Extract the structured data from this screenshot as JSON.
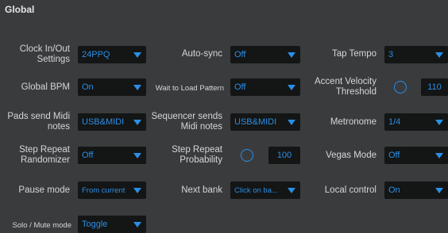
{
  "panel": {
    "title": "Global"
  },
  "rows": {
    "clock": {
      "label": "Clock In/Out Settings",
      "value": "24PPQ"
    },
    "auto_sync": {
      "label": "Auto-sync",
      "value": "Off"
    },
    "tap_tempo": {
      "label": "Tap Tempo",
      "value": "3"
    },
    "global_bpm": {
      "label": "Global BPM",
      "value": "On"
    },
    "wait_load": {
      "label": "Wait to Load Pattern",
      "value": "Off"
    },
    "accent_velocity": {
      "label": "Accent Velocity Threshold",
      "value": "110"
    },
    "pads_midi": {
      "label": "Pads send Midi notes",
      "value": "USB&MIDI"
    },
    "sequencer_midi": {
      "label": "Sequencer sends Midi notes",
      "value": "USB&MIDI"
    },
    "metronome": {
      "label": "Metronome",
      "value": "1/4"
    },
    "step_repeat_random": {
      "label": "Step Repeat Randomizer",
      "value": "Off"
    },
    "step_repeat_prob": {
      "label": "Step Repeat Probability",
      "value": "100"
    },
    "vegas_mode": {
      "label": "Vegas Mode",
      "value": "Off"
    },
    "pause_mode": {
      "label": "Pause mode",
      "value": "From current"
    },
    "next_bank": {
      "label": "Next bank",
      "value": "Click on ba..."
    },
    "local_control": {
      "label": "Local control",
      "value": "On"
    },
    "solo_mute": {
      "label": "Solo / Mute mode",
      "value": "Toggle"
    }
  },
  "colors": {
    "accent": "#2a8fe6",
    "background": "#3a3b3d",
    "field": "#141515"
  }
}
